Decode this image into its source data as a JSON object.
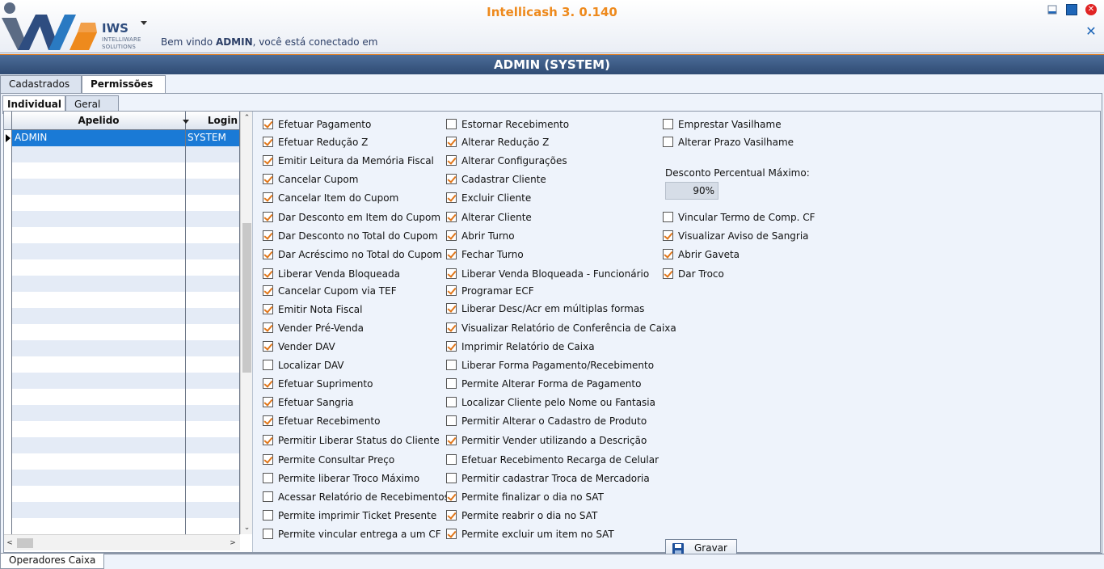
{
  "app": {
    "title": "Intellicash 3. 0.140",
    "logo_name": "IWS",
    "logo_sub1": "INTELLIWARE",
    "logo_sub2": "SOLUTIONS",
    "welcome_prefix": "Bem vindo ",
    "welcome_user": "ADMIN",
    "welcome_suffix": ", você está conectado em",
    "user_bar": "ADMIN (SYSTEM)"
  },
  "colors": {
    "accent": "#ee8a1d",
    "header_bar": "#3c5a84",
    "selection": "#1a7ad6"
  },
  "tabs_main": [
    {
      "label": "Cadastrados",
      "active": false
    },
    {
      "label": "Permissões",
      "active": true
    }
  ],
  "tabs_sub": [
    {
      "label": "Individual",
      "active": true
    },
    {
      "label": "Geral",
      "active": false
    }
  ],
  "grid": {
    "col_apelido": "Apelido",
    "col_login": "Login",
    "rows": [
      {
        "apelido": "ADMIN",
        "login": "SYSTEM"
      }
    ]
  },
  "permissions": {
    "col1": [
      {
        "label": "Efetuar Pagamento",
        "checked": true
      },
      {
        "label": "Efetuar Redução Z",
        "checked": true
      },
      {
        "label": "Emitir Leitura da Memória Fiscal",
        "checked": true
      },
      {
        "label": "Cancelar Cupom",
        "checked": true
      },
      {
        "label": "Cancelar Item do Cupom",
        "checked": true
      },
      {
        "label": "Dar Desconto em Item do Cupom",
        "checked": true
      },
      {
        "label": "Dar Desconto no Total do Cupom",
        "checked": true
      },
      {
        "label": "Dar Acréscimo no Total do Cupom",
        "checked": true
      },
      {
        "label": "Liberar Venda Bloqueada",
        "checked": true
      },
      {
        "label": "Cancelar Cupom via TEF",
        "checked": true
      },
      {
        "label": "Emitir Nota Fiscal",
        "checked": true
      },
      {
        "label": "Vender Pré-Venda",
        "checked": true
      },
      {
        "label": "Vender DAV",
        "checked": true
      },
      {
        "label": "Localizar DAV",
        "checked": false
      },
      {
        "label": "Efetuar Suprimento",
        "checked": true
      },
      {
        "label": "Efetuar Sangria",
        "checked": true
      },
      {
        "label": "Efetuar Recebimento",
        "checked": true
      },
      {
        "label": "Permitir Liberar Status do Cliente",
        "checked": true
      },
      {
        "label": "Permite Consultar Preço",
        "checked": true
      },
      {
        "label": "Permite liberar Troco Máximo",
        "checked": false
      },
      {
        "label": "Acessar Relatório de Recebimentos",
        "checked": false
      },
      {
        "label": "Permite imprimir Ticket Presente",
        "checked": false
      },
      {
        "label": "Permite vincular entrega a um CF",
        "checked": false
      }
    ],
    "col2": [
      {
        "label": "Estornar Recebimento",
        "checked": false
      },
      {
        "label": "Alterar Redução Z",
        "checked": true
      },
      {
        "label": "Alterar Configurações",
        "checked": true
      },
      {
        "label": "Cadastrar Cliente",
        "checked": true
      },
      {
        "label": "Excluir Cliente",
        "checked": true
      },
      {
        "label": "Alterar Cliente",
        "checked": true
      },
      {
        "label": "Abrir Turno",
        "checked": true
      },
      {
        "label": "Fechar Turno",
        "checked": true
      },
      {
        "label": "Liberar Venda Bloqueada - Funcionário",
        "checked": true
      },
      {
        "label": "Programar ECF",
        "checked": true
      },
      {
        "label": "Liberar Desc/Acr em múltiplas formas",
        "checked": true
      },
      {
        "label": "Visualizar Relatório de Conferência de Caixa",
        "checked": true
      },
      {
        "label": "Imprimir Relatório de Caixa",
        "checked": true
      },
      {
        "label": "Liberar Forma Pagamento/Recebimento",
        "checked": false
      },
      {
        "label": "Permite Alterar Forma de Pagamento",
        "checked": false
      },
      {
        "label": "Localizar Cliente pelo Nome ou Fantasia",
        "checked": false
      },
      {
        "label": "Permitir Alterar o Cadastro de Produto",
        "checked": false
      },
      {
        "label": "Permitir Vender utilizando a Descrição",
        "checked": true
      },
      {
        "label": "Efetuar Recebimento Recarga de Celular",
        "checked": false
      },
      {
        "label": "Permitir cadastrar Troca de Mercadoria",
        "checked": false
      },
      {
        "label": "Permite finalizar o dia no SAT",
        "checked": true
      },
      {
        "label": "Permite reabrir o dia no SAT",
        "checked": true
      },
      {
        "label": "Permite excluir um item no SAT",
        "checked": true
      }
    ],
    "col3_top": [
      {
        "label": "Emprestar Vasilhame",
        "checked": false
      },
      {
        "label": "Alterar Prazo Vasilhame",
        "checked": false
      }
    ],
    "desconto_label": "Desconto Percentual Máximo:",
    "desconto_value": "90%",
    "col3_bottom": [
      {
        "label": "Vincular Termo de Comp. CF",
        "checked": false
      },
      {
        "label": "Visualizar Aviso de Sangria",
        "checked": true
      },
      {
        "label": "Abrir Gaveta",
        "checked": true
      },
      {
        "label": "Dar Troco",
        "checked": true
      }
    ]
  },
  "save_label": "Gravar",
  "bottom_tab": "Operadores Caixa"
}
